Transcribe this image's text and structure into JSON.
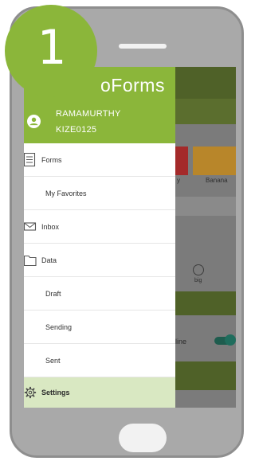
{
  "step_badge": {
    "number": "1"
  },
  "drawer": {
    "brand_text": "oForms",
    "user": {
      "name": "RAMAMURTHY",
      "id": "KIZE0125"
    },
    "items": [
      {
        "label": "Forms",
        "icon": "document-icon"
      },
      {
        "label": "My Favorites"
      },
      {
        "label": "Inbox",
        "icon": "envelope-icon"
      },
      {
        "label": "Data",
        "icon": "folder-icon"
      },
      {
        "label": "Draft"
      },
      {
        "label": "Sending"
      },
      {
        "label": "Sent"
      },
      {
        "label": "Settings",
        "icon": "gear-icon",
        "selected": true
      }
    ]
  },
  "background_app": {
    "tile_labels": [
      "y",
      "Banana"
    ],
    "circle_label": "big",
    "toggle_label": "line",
    "toggle_on": true
  },
  "colors": {
    "accent": "#8bb63a",
    "selected_bg": "#d9e8c2",
    "toggle": "#1f6d5d"
  }
}
